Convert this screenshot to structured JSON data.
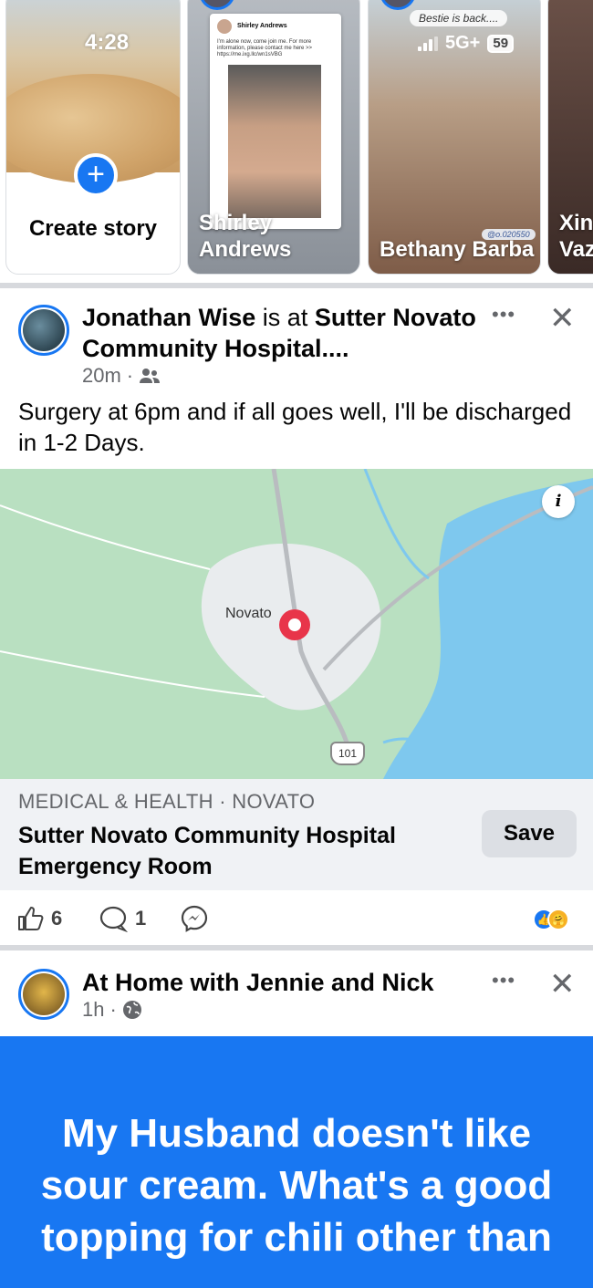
{
  "status_bar": {
    "time": "4:28",
    "network": "5G+",
    "battery": "59"
  },
  "stories": {
    "create_label": "Create story",
    "items": [
      {
        "name": "Shirley Andrews",
        "inner_name": "Shirley Andrews",
        "inner_text": "I'm alone now, come join me. For more information, please contact me here >> https://me.ixg.llc/wn1sVBG"
      },
      {
        "name": "Bethany Barba",
        "caption": "Bestie is back....",
        "tag": "@o.020550"
      },
      {
        "name": "Xin Vaz"
      }
    ]
  },
  "post1": {
    "author": "Jonathan Wise",
    "connector": " is at ",
    "place_link": "Sutter Novato Community Hospital....",
    "time": "20m",
    "dot": "·",
    "body": "Surgery at 6pm and if all goes well, I'll be discharged in 1-2 Days.",
    "map": {
      "town": "Novato",
      "highway": "101",
      "info": "i"
    },
    "place_card": {
      "category": "MEDICAL & HEALTH · NOVATO",
      "name": "Sutter Novato Community Hospital Emergency Room",
      "save_label": "Save"
    },
    "likes": "6",
    "comments": "1"
  },
  "post2": {
    "author": "At Home with Jennie and Nick",
    "time": "1h",
    "dot": "·",
    "text": "My Husband doesn't like sour cream. What's a good topping for chili other than"
  },
  "colors": {
    "accent": "#1877f2",
    "text_post_bg": "#1877f2",
    "map_water": "#7ec8ee",
    "map_land": "#b8dfc0",
    "pin": "#e8354a"
  },
  "icons": [
    "plus-icon",
    "more-icon",
    "close-icon",
    "friends-icon",
    "globe-icon",
    "like-icon",
    "comment-icon",
    "messenger-icon",
    "info-icon",
    "map-pin-icon"
  ]
}
